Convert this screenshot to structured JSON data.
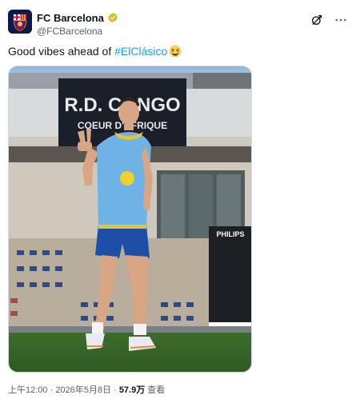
{
  "account": {
    "display_name": "FC Barcelona",
    "handle": "@FCBarcelona",
    "verified_badge": "gold-verified-badge-icon"
  },
  "tweet": {
    "text_prefix": "Good vibes ahead of ",
    "hashtag": "#ElClásico",
    "emoji": "grinning-squinting-face"
  },
  "photo": {
    "building_sign_line1": "R.D. CONGO",
    "building_sign_line2": "COEUR D'AFRIQUE",
    "side_sign": "PHILIPS"
  },
  "meta": {
    "time": "上午12:00",
    "separator": " · ",
    "date": "2026年5月8日",
    "views_count": "57.9万",
    "views_label": " 查看"
  },
  "colors": {
    "accent": "#1d9bf0",
    "verified": "#e2b719",
    "muted_text": "#536471"
  }
}
